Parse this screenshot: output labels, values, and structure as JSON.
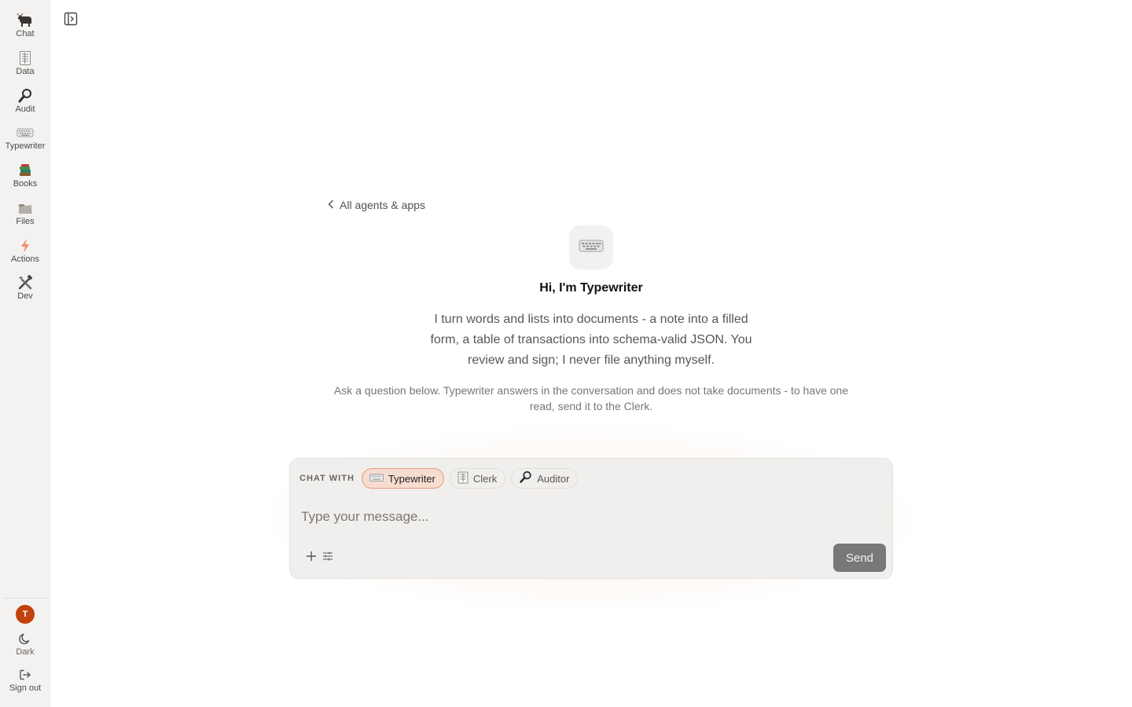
{
  "sidebar": {
    "items": [
      {
        "label": "Chat",
        "icon": "ox-icon"
      },
      {
        "label": "Data",
        "icon": "ledger-icon"
      },
      {
        "label": "Audit",
        "icon": "magnifier-icon"
      },
      {
        "label": "Typewriter",
        "icon": "keyboard-icon"
      },
      {
        "label": "Books",
        "icon": "books-icon"
      },
      {
        "label": "Files",
        "icon": "folder-icon"
      },
      {
        "label": "Actions",
        "icon": "lightning-icon"
      },
      {
        "label": "Dev",
        "icon": "tools-icon"
      }
    ],
    "user_initial": "T",
    "theme_label": "Dark",
    "signout_label": "Sign out"
  },
  "main": {
    "back_link": "All agents & apps",
    "agent_icon": "keyboard-icon",
    "greeting": "Hi, I'm Typewriter",
    "description": "I turn words and lists into documents - a note into a filled form, a table of transactions into schema-valid JSON. You review and sign; I never file anything myself.",
    "hint": "Ask a question below. Typewriter answers in the conversation and does not take documents - to have one read, send it to the Clerk."
  },
  "composer": {
    "chat_with_label": "CHAT WITH",
    "agents": [
      {
        "label": "Typewriter",
        "icon": "keyboard-icon",
        "active": true
      },
      {
        "label": "Clerk",
        "icon": "ledger-icon",
        "active": false
      },
      {
        "label": "Auditor",
        "icon": "magnifier-icon",
        "active": false
      }
    ],
    "placeholder": "Type your message...",
    "send_label": "Send"
  },
  "colors": {
    "accent": "#c2410c",
    "chip_active_bg": "#f7ddd0",
    "chip_active_border": "#e39b7a",
    "send_bg": "#7a7876",
    "sidebar_bg": "#f3f2f0"
  }
}
